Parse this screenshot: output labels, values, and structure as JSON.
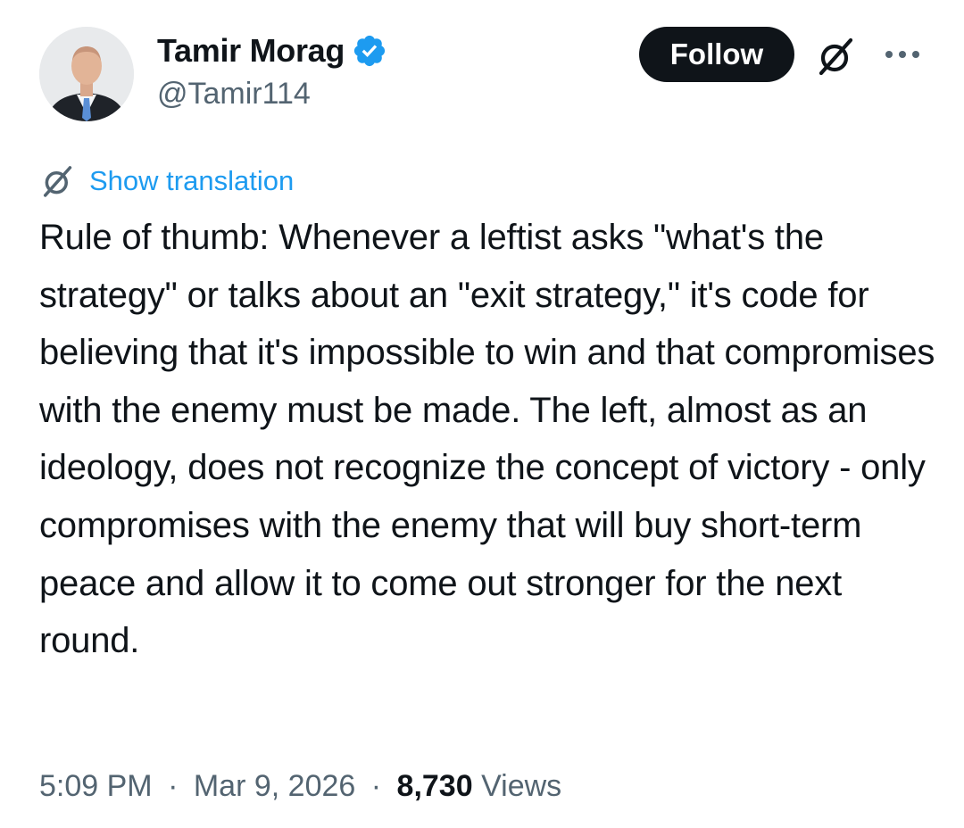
{
  "author": {
    "display_name": "Tamir Morag",
    "handle": "@Tamir114",
    "verified": true
  },
  "actions": {
    "follow_label": "Follow",
    "grok_icon": "grok-icon",
    "more_icon": "more-options-icon"
  },
  "translation": {
    "link_label": "Show translation",
    "icon": "grok-icon"
  },
  "tweet": {
    "text": "Rule of thumb: Whenever a leftist asks \"what's the strategy\" or talks about an \"exit strategy,\" it's code for believing that it's impossible to win and that compromises with the enemy must be made. The left, almost as an ideology, does not recognize the concept of victory - only compromises with the enemy that will buy short-term peace and allow it to come out stronger for the next round."
  },
  "meta": {
    "time": "5:09 PM",
    "date": "Mar 9, 2026",
    "views_count": "8,730",
    "views_label": "Views",
    "separator": "·"
  },
  "colors": {
    "text_primary": "#0f1419",
    "text_secondary": "#536471",
    "link": "#1d9bf0",
    "verified_badge": "#1d9bf0",
    "follow_bg": "#0f1419"
  }
}
